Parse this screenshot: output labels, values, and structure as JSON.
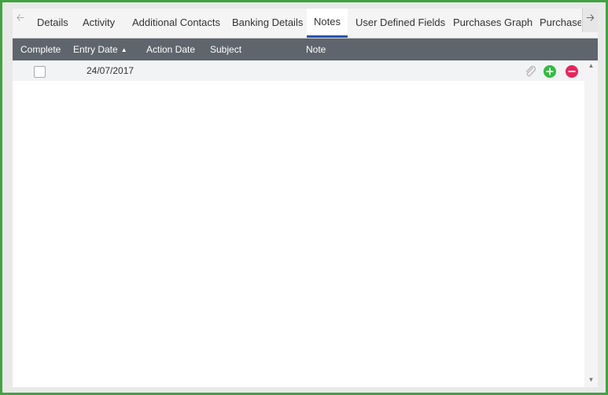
{
  "tabs": [
    {
      "label": "Details",
      "active": false
    },
    {
      "label": "Activity",
      "active": false
    },
    {
      "label": "Additional Contacts",
      "active": false
    },
    {
      "label": "Banking Details",
      "active": false
    },
    {
      "label": "Notes",
      "active": true
    },
    {
      "label": "User Defined Fields",
      "active": false
    },
    {
      "label": "Purchases Graph",
      "active": false
    },
    {
      "label": "Purchase Orders",
      "active": false
    }
  ],
  "nav": {
    "left_icon": "arrow-left-icon",
    "right_icon": "arrow-right-icon"
  },
  "grid": {
    "columns": [
      "Complete",
      "Entry Date",
      "Action Date",
      "Subject",
      "Note"
    ],
    "sort_column": "Entry Date",
    "sort_direction": "ascending",
    "rows": [
      {
        "complete": false,
        "entry_date": "24/07/2017",
        "action_date": "",
        "subject": "",
        "note": ""
      }
    ],
    "row_icons": [
      "attachment-icon",
      "add-icon",
      "remove-icon"
    ]
  },
  "colors": {
    "frame": "#3fa33f",
    "header_bg": "#5f656d",
    "active_tab": "#2a56b0",
    "add": "#2dbe3c",
    "remove": "#e8245a"
  }
}
